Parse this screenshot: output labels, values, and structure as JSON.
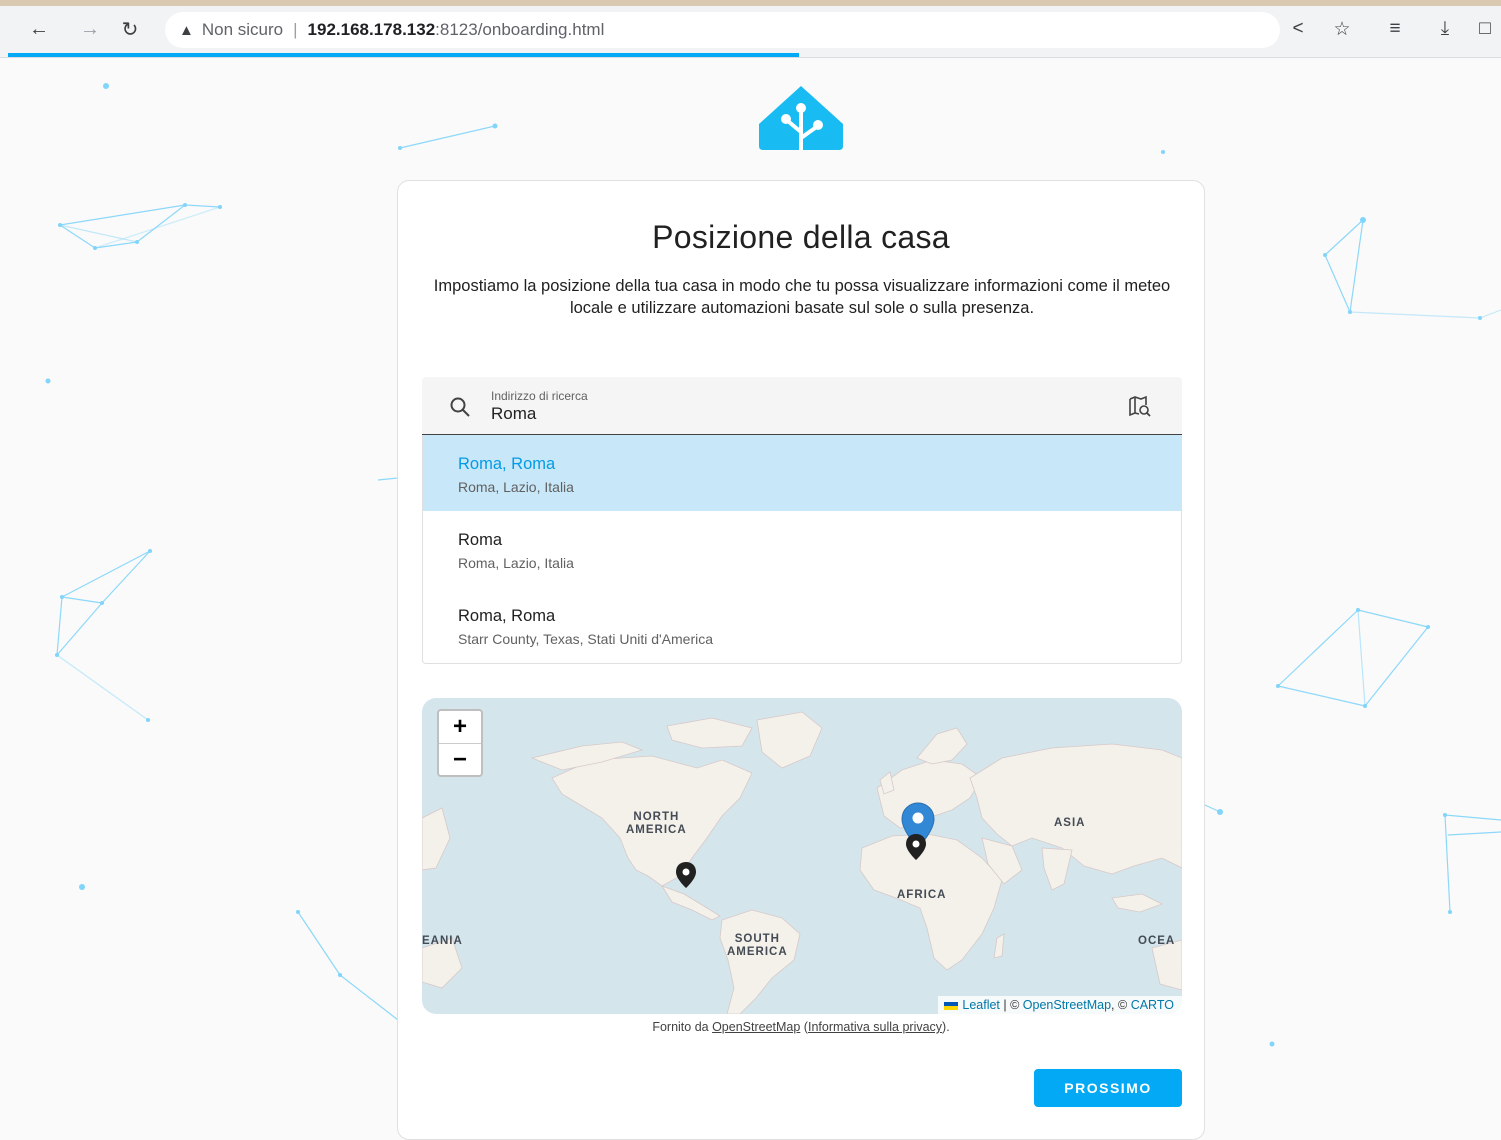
{
  "browser": {
    "back_icon": "arrow-left-icon",
    "forward_icon": "arrow-right-icon",
    "reload_icon": "reload-icon",
    "security_label": "Non sicuro",
    "url_host": "192.168.178.132",
    "url_rest": ":8123/onboarding.html",
    "toolbar_icons": [
      "share-icon",
      "star-icon",
      "reading-list-icon",
      "download-icon",
      "side-panel-icon"
    ],
    "loading_progress": 0.53
  },
  "page": {
    "title": "Posizione della casa",
    "intro": "Impostiamo la posizione della tua casa in modo che tu possa visualizzare informazioni come il meteo locale e utilizzare automazioni basate sul sole o sulla presenza.",
    "accent": "#03a9f4"
  },
  "search": {
    "label": "Indirizzo di ricerca",
    "value": "Roma"
  },
  "suggestions": [
    {
      "title": "Roma, Roma",
      "subtitle": "Roma, Lazio, Italia",
      "active": true
    },
    {
      "title": "Roma",
      "subtitle": "Roma, Lazio, Italia",
      "active": false
    },
    {
      "title": "Roma, Roma",
      "subtitle": "Starr County, Texas, Stati Uniti d'America",
      "active": false
    }
  ],
  "map": {
    "zoom_in": "+",
    "zoom_out": "−",
    "labels": {
      "north_america_1": "NORTH",
      "north_america_2": "AMERICA",
      "asia": "ASIA",
      "africa": "AFRICA",
      "south_america_1": "SOUTH",
      "south_america_2": "AMERICA",
      "oceania_left": "EANIA",
      "oceania_right": "OCEA"
    },
    "attribution": {
      "leaflet": "Leaflet",
      "sep": " | © ",
      "osm": "OpenStreetMap",
      "sep2": ", © ",
      "carto": "CARTO"
    }
  },
  "credit": {
    "prefix": "Fornito da ",
    "osm": "OpenStreetMap",
    "mid": " (",
    "privacy": "Informativa sulla privacy",
    "suffix": ")."
  },
  "next_button": "PROSSIMO"
}
